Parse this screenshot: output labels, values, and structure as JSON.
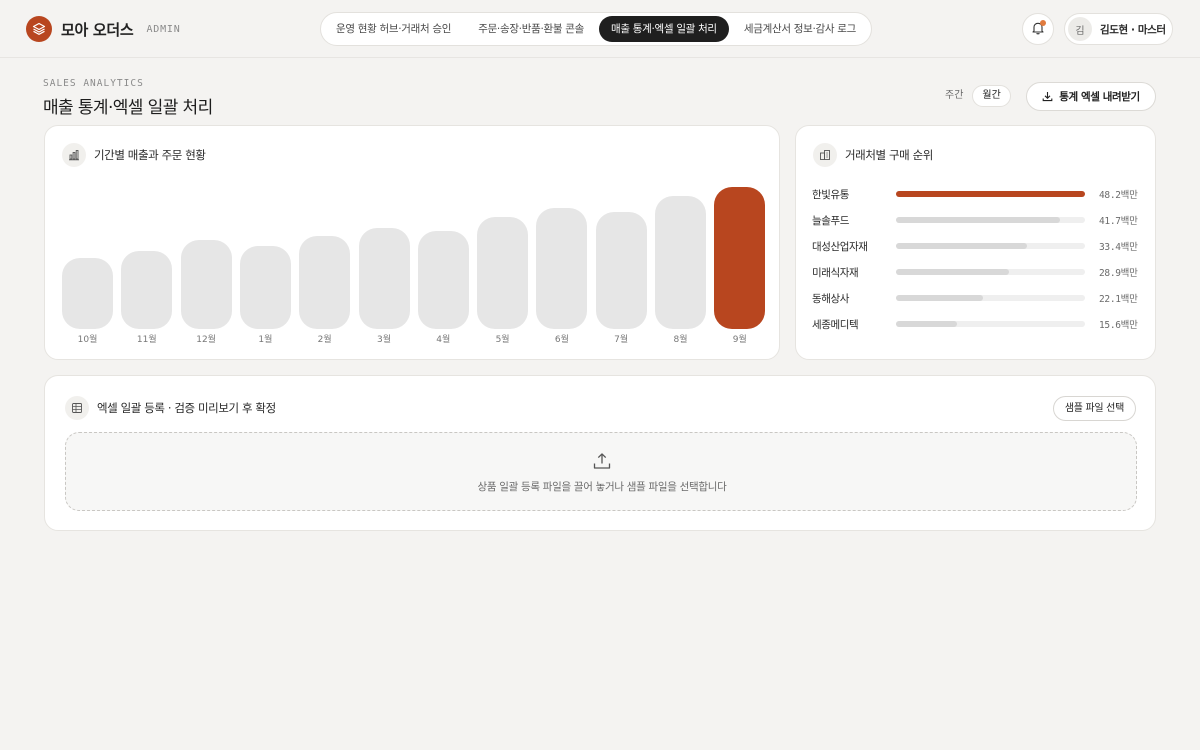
{
  "brand": {
    "name": "모아 오더스",
    "tag": "ADMIN"
  },
  "nav": {
    "tabs": [
      {
        "label": "운영 현황 허브·거래처 승인",
        "active": false
      },
      {
        "label": "주문·송장·반품·환불 콘솔",
        "active": false
      },
      {
        "label": "매출 통계·엑셀 일괄 처리",
        "active": true
      },
      {
        "label": "세금계산서 정보·감사 로그",
        "active": false
      }
    ]
  },
  "header": {
    "notifications_icon": "bell-icon",
    "user_initial": "김",
    "user_name": "김도현 · 마스터"
  },
  "page": {
    "eyebrow": "SALES ANALYTICS",
    "title": "매출 통계·엑셀 일괄 처리",
    "period_options": [
      {
        "label": "주간",
        "active": false
      },
      {
        "label": "월간",
        "active": true
      }
    ],
    "export_label": "통계 엑셀 내려받기"
  },
  "sales_card": {
    "title": "기간별 매출과 주문 현황",
    "icon": "bar-chart-icon"
  },
  "chart_data": {
    "type": "bar",
    "categories": [
      "10월",
      "11월",
      "12월",
      "1월",
      "2월",
      "3월",
      "4월",
      "5월",
      "6월",
      "7월",
      "8월",
      "9월"
    ],
    "values": [
      71,
      77,
      88,
      82,
      92,
      100,
      97,
      111,
      120,
      116,
      132,
      141
    ],
    "highlight_index": 11,
    "colors": {
      "bar": "#e6e6e6",
      "highlight": "#b8461f"
    }
  },
  "rank_card": {
    "title": "거래처별 구매 순위",
    "icon": "buildings-icon",
    "items": [
      {
        "name": "한빛유통",
        "value": "48.2백만",
        "amount": 48.2
      },
      {
        "name": "늘솔푸드",
        "value": "41.7백만",
        "amount": 41.7
      },
      {
        "name": "대성산업자재",
        "value": "33.4백만",
        "amount": 33.4
      },
      {
        "name": "미래식자재",
        "value": "28.9백만",
        "amount": 28.9
      },
      {
        "name": "동해상사",
        "value": "22.1백만",
        "amount": 22.1
      },
      {
        "name": "세종메디텍",
        "value": "15.6백만",
        "amount": 15.6
      }
    ]
  },
  "upload_card": {
    "title": "엑셀 일괄 등록 · 검증 미리보기 후 확정",
    "icon": "spreadsheet-icon",
    "sample_button": "샘플 파일 선택",
    "dropzone_text": "상품 일괄 등록 파일을 끌어 놓거나 샘플 파일을 선택합니다",
    "dropzone_icon": "upload-icon"
  }
}
